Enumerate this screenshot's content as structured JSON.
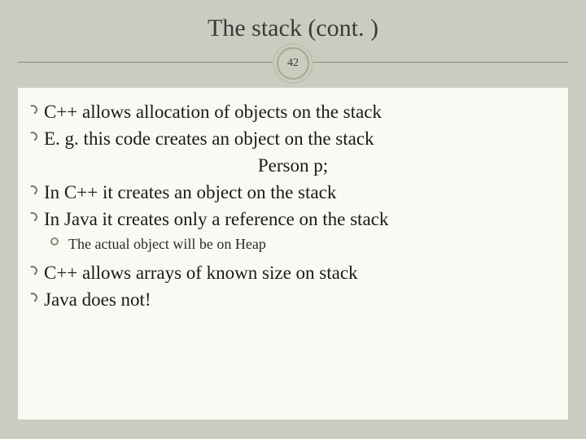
{
  "title": "The stack (cont. )",
  "badge": "42",
  "bullets": {
    "b0": "C++ allows allocation of objects on the stack",
    "b1": "E. g. this code creates an object on the stack",
    "center": "Person p;",
    "b2": "In C++ it creates an object on the stack",
    "b3": "In Java it creates only a reference on the stack",
    "sub0": "The actual object will be on Heap",
    "b4": "C++ allows arrays of known size on stack",
    "b5": "Java does not!"
  }
}
